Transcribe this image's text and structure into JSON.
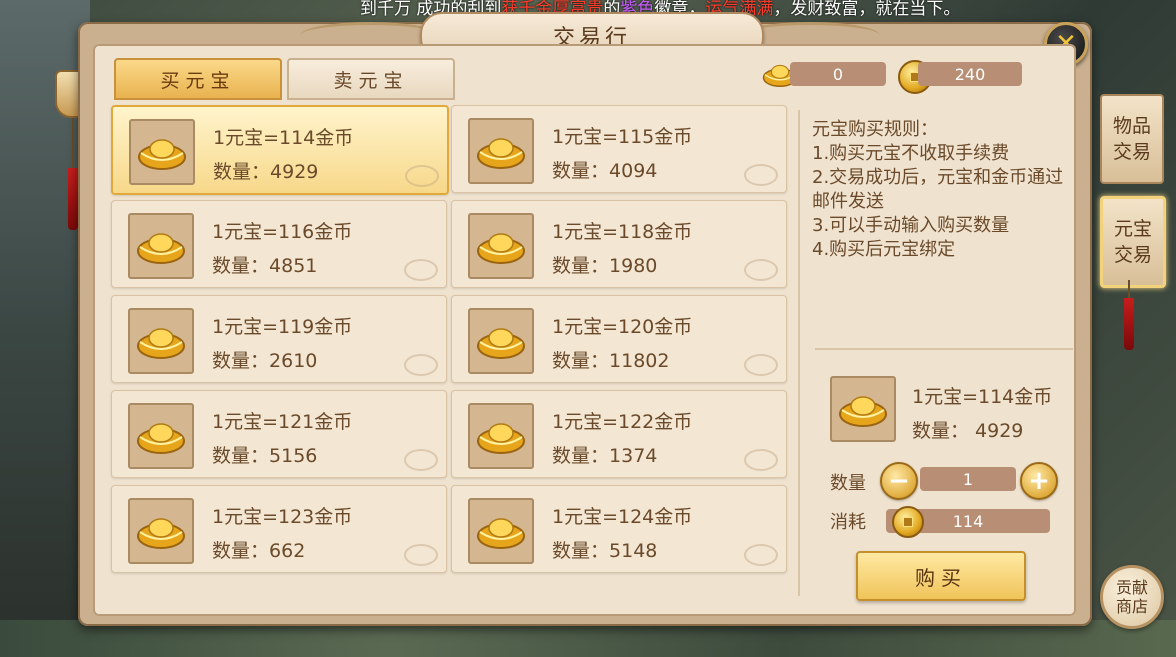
{
  "marquee": {
    "parts": [
      {
        "text": "到千万",
        "color": "#ffffff"
      },
      {
        "text": " 成功的刮到",
        "color": "#ffffff"
      },
      {
        "text": "获千金厚富贵",
        "color": "#ff3b2a"
      },
      {
        "text": "的",
        "color": "#ffffff"
      },
      {
        "text": "紫色",
        "color": "#c95bff"
      },
      {
        "text": "徽章，",
        "color": "#ffffff"
      },
      {
        "text": "运气满满",
        "color": "#ff3b2a"
      },
      {
        "text": "，发财致富，就在当下。",
        "color": "#ffffff"
      }
    ]
  },
  "window": {
    "title": "交易行",
    "close_icon": "close-x-icon"
  },
  "tabs": {
    "buy": "买元宝",
    "sell": "卖元宝",
    "active": "buy"
  },
  "currency": {
    "yuanbao_amount": "0",
    "gold_amount": "240",
    "yuanbao_icon": "gold-ingot-icon",
    "gold_icon": "gold-coin-icon"
  },
  "qty_prefix": "数量：",
  "offers": [
    {
      "rate": "1元宝=114金币",
      "qty": "4929",
      "selected": true
    },
    {
      "rate": "1元宝=115金币",
      "qty": "4094",
      "selected": false
    },
    {
      "rate": "1元宝=116金币",
      "qty": "4851",
      "selected": false
    },
    {
      "rate": "1元宝=118金币",
      "qty": "1980",
      "selected": false
    },
    {
      "rate": "1元宝=119金币",
      "qty": "2610",
      "selected": false
    },
    {
      "rate": "1元宝=120金币",
      "qty": "11802",
      "selected": false
    },
    {
      "rate": "1元宝=121金币",
      "qty": "5156",
      "selected": false
    },
    {
      "rate": "1元宝=122金币",
      "qty": "1374",
      "selected": false
    },
    {
      "rate": "1元宝=123金币",
      "qty": "662",
      "selected": false
    },
    {
      "rate": "1元宝=124金币",
      "qty": "5148",
      "selected": false
    }
  ],
  "rules": {
    "title": "元宝购买规则：",
    "items": [
      "1.购买元宝不收取手续费",
      "2.交易成功后，元宝和金币通过邮件发送",
      "3.可以手动输入购买数量",
      "4.购买后元宝绑定"
    ]
  },
  "detail": {
    "rate": "1元宝=114金币",
    "qty_line": "数量：  4929",
    "quantity_label": "数量",
    "quantity_value": "1",
    "cost_label": "消耗",
    "cost_value": "114",
    "buy_button": "购买"
  },
  "side_tabs": {
    "goods": [
      "物品",
      "交易"
    ],
    "yuanbao": [
      "元宝",
      "交易"
    ],
    "active": "yuanbao"
  },
  "shop_button": [
    "贡献",
    "商店"
  ]
}
